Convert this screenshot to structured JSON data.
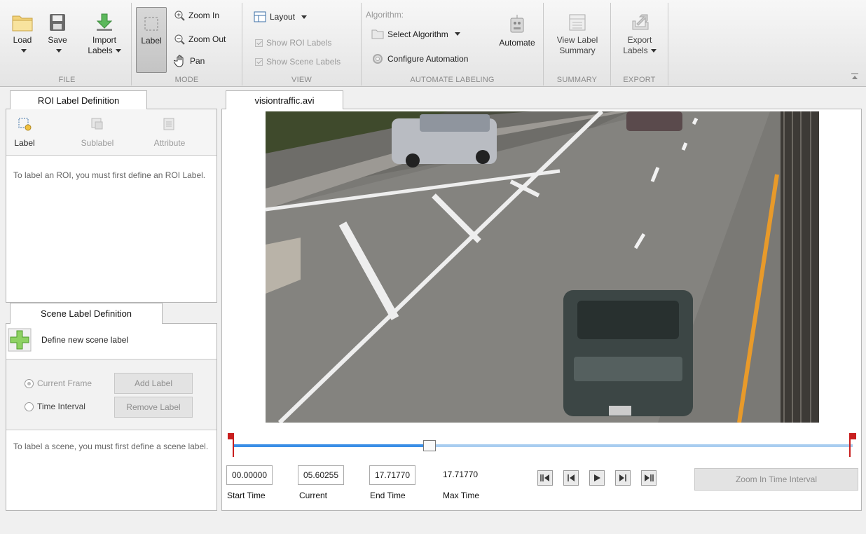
{
  "ribbon": {
    "file": {
      "title": "FILE",
      "load": "Load",
      "save": "Save",
      "import_line1": "Import",
      "import_line2": "Labels"
    },
    "mode": {
      "title": "MODE",
      "label": "Label",
      "zoom_in": "Zoom In",
      "zoom_out": "Zoom Out",
      "pan": "Pan"
    },
    "view": {
      "title": "VIEW",
      "layout": "Layout",
      "show_roi": "Show ROI Labels",
      "show_scene": "Show Scene Labels"
    },
    "automate": {
      "title": "AUTOMATE LABELING",
      "algorithm_caption": "Algorithm:",
      "select_algorithm": "Select Algorithm",
      "configure": "Configure Automation",
      "automate": "Automate"
    },
    "summary": {
      "title": "SUMMARY",
      "line1": "View Label",
      "line2": "Summary"
    },
    "export": {
      "title": "EXPORT",
      "line1": "Export",
      "line2": "Labels"
    }
  },
  "roi_panel": {
    "tab": "ROI Label Definition",
    "label_btn": "Label",
    "sublabel_btn": "Sublabel",
    "attribute_btn": "Attribute",
    "hint": "To label an ROI, you must first define an ROI Label."
  },
  "scene_panel": {
    "tab": "Scene Label Definition",
    "define": "Define new scene label",
    "current_frame": "Current Frame",
    "time_interval": "Time Interval",
    "add_label": "Add Label",
    "remove_label": "Remove Label",
    "hint": "To label a scene, you must first define a scene label."
  },
  "video": {
    "tab": "visiontraffic.avi",
    "progress": 0.3163
  },
  "time": {
    "start_value": "00.00000",
    "start_label": "Start Time",
    "current_value": "05.60255",
    "current_label": "Current",
    "end_value": "17.71770",
    "end_label": "End Time",
    "max_value": "17.71770",
    "max_label": "Max Time",
    "zoom_interval": "Zoom In Time Interval"
  },
  "colors": {
    "accent": "#3a8ee6",
    "track_light": "#a8cdf0",
    "flag": "#c81e1e"
  }
}
